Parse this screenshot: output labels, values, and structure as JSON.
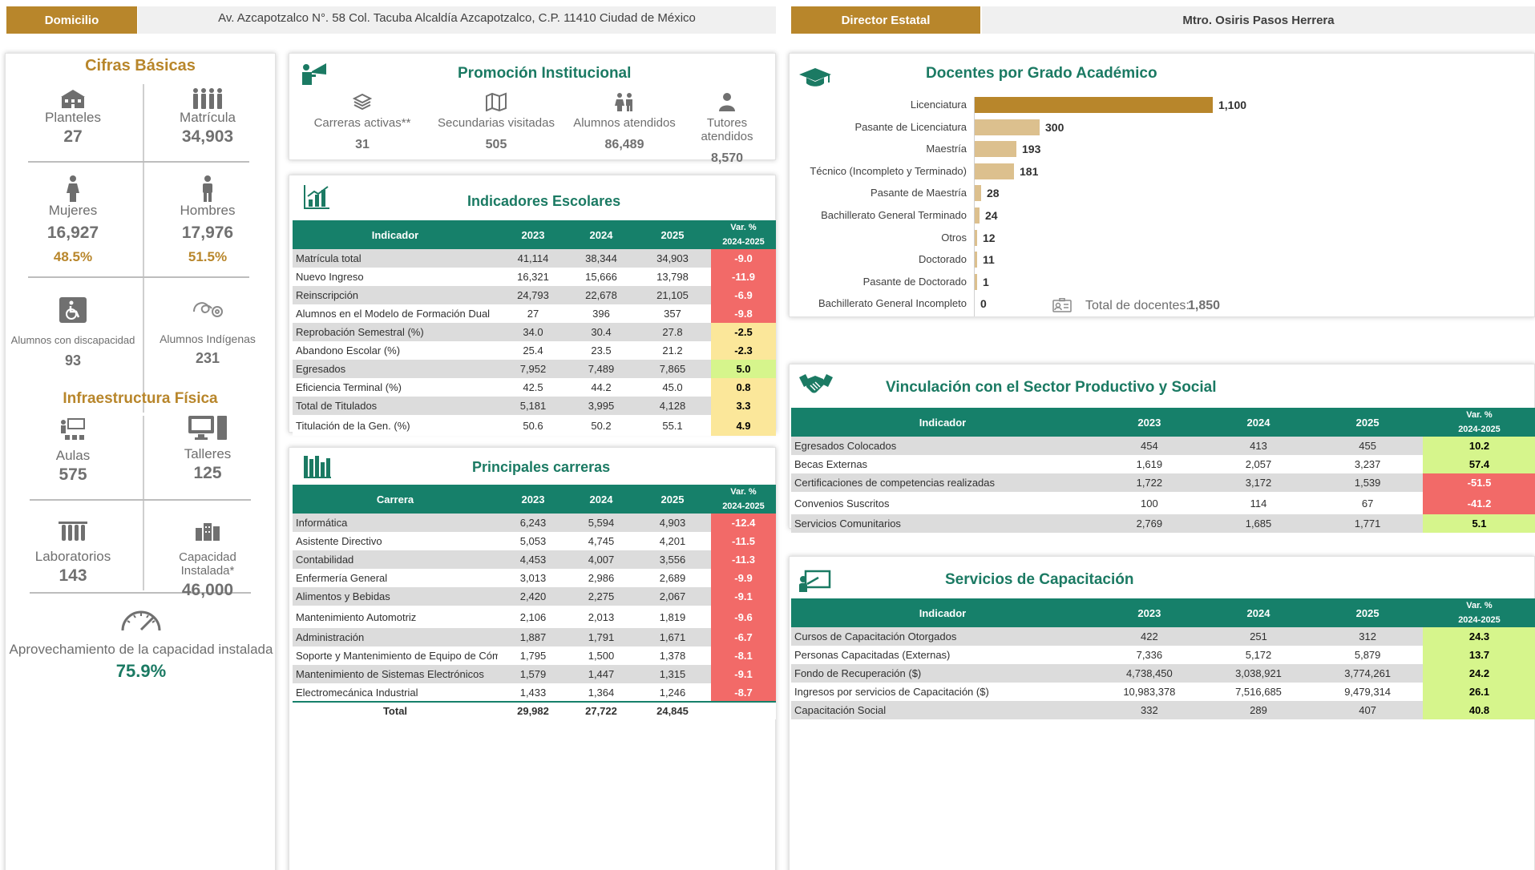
{
  "header": {
    "domicilio_label": "Domicilio",
    "domicilio_value": "Av. Azcapotzalco N°. 58 Col. Tacuba Alcaldía Azcapotzalco, C.P. 11410 Ciudad de México",
    "director_label": "Director Estatal",
    "director_value": "Mtro. Osiris Pasos Herrera"
  },
  "cifras": {
    "title": "Cifras Básicas",
    "planteles_label": "Planteles",
    "planteles_value": "27",
    "matricula_label": "Matrícula",
    "matricula_value": "34,903",
    "mujeres_label": "Mujeres",
    "mujeres_value": "16,927",
    "mujeres_pct": "48.5%",
    "hombres_label": "Hombres",
    "hombres_value": "17,976",
    "hombres_pct": "51.5%",
    "discapacidad_label": "Alumnos con discapacidad",
    "discapacidad_value": "93",
    "indigenas_label": "Alumnos Indígenas",
    "indigenas_value": "231"
  },
  "infraestructura": {
    "title": "Infraestructura Física",
    "aulas_label": "Aulas",
    "aulas_value": "575",
    "talleres_label": "Talleres",
    "talleres_value": "125",
    "laboratorios_label": "Laboratorios",
    "laboratorios_value": "143",
    "capacidad_label": "Capacidad Instalada*",
    "capacidad_value": "46,000",
    "aprovechamiento_label": "Aprovechamiento de la capacidad instalada",
    "aprovechamiento_value": "75.9%"
  },
  "promocion": {
    "title": "Promoción Institucional",
    "carreras_label": "Carreras activas**",
    "carreras_value": "31",
    "secundarias_label": "Secundarias visitadas",
    "secundarias_value": "505",
    "alumnos_label": "Alumnos atendidos",
    "alumnos_value": "86,489",
    "tutores_label": "Tutores atendidos",
    "tutores_value": "8,570"
  },
  "indicadores": {
    "title": "Indicadores Escolares",
    "head": [
      "Indicador",
      "2023",
      "2024",
      "2025",
      "Var. %",
      "2024-2025"
    ],
    "rows": [
      [
        "Matrícula total",
        "41,114",
        "38,344",
        "34,903",
        "-9.0"
      ],
      [
        "Nuevo Ingreso",
        "16,321",
        "15,666",
        "13,798",
        "-11.9"
      ],
      [
        "Reinscripción",
        "24,793",
        "22,678",
        "21,105",
        "-6.9"
      ],
      [
        "Alumnos en el Modelo de Formación Dual",
        "27",
        "396",
        "357",
        "-9.8"
      ],
      [
        "Reprobación Semestral (%)",
        "34.0",
        "30.4",
        "27.8",
        "-2.5"
      ],
      [
        "Abandono Escolar (%)",
        "25.4",
        "23.5",
        "21.2",
        "-2.3"
      ],
      [
        "Egresados",
        "7,952",
        "7,489",
        "7,865",
        "5.0"
      ],
      [
        "Eficiencia Terminal (%)",
        "42.5",
        "44.2",
        "45.0",
        "0.8"
      ],
      [
        "Total de Titulados",
        "5,181",
        "3,995",
        "4,128",
        "3.3"
      ],
      [
        "Titulación de la Gen. (%)",
        "50.6",
        "50.2",
        "55.1",
        "4.9"
      ]
    ]
  },
  "carreras": {
    "title": "Principales carreras",
    "head": [
      "Carrera",
      "2023",
      "2024",
      "2025",
      "Var. %",
      "2024-2025"
    ],
    "rows": [
      [
        "Informática",
        "6,243",
        "5,594",
        "4,903",
        "-12.4"
      ],
      [
        "Asistente Directivo",
        "5,053",
        "4,745",
        "4,201",
        "-11.5"
      ],
      [
        "Contabilidad",
        "4,453",
        "4,007",
        "3,556",
        "-11.3"
      ],
      [
        "Enfermería General",
        "3,013",
        "2,986",
        "2,689",
        "-9.9"
      ],
      [
        "Alimentos y Bebidas",
        "2,420",
        "2,275",
        "2,067",
        "-9.1"
      ],
      [
        "Mantenimiento Automotriz",
        "2,106",
        "2,013",
        "1,819",
        "-9.6"
      ],
      [
        "Administración",
        "1,887",
        "1,791",
        "1,671",
        "-6.7"
      ],
      [
        "Soporte y Mantenimiento de Equipo de Cómputo",
        "1,795",
        "1,500",
        "1,378",
        "-8.1"
      ],
      [
        "Mantenimiento de Sistemas Electrónicos",
        "1,579",
        "1,447",
        "1,315",
        "-9.1"
      ],
      [
        "Electromecánica Industrial",
        "1,433",
        "1,364",
        "1,246",
        "-8.7"
      ]
    ],
    "total": [
      "Total",
      "29,982",
      "27,722",
      "24,845"
    ]
  },
  "docentes": {
    "title": "Docentes por Grado Académico",
    "total_label": "Total de docentes:",
    "total_value": "1,850",
    "chart_data": {
      "type": "bar",
      "categories": [
        "Licenciatura",
        "Pasante de Licenciatura",
        "Maestría",
        "Técnico (Incompleto y Terminado)",
        "Pasante de Maestría",
        "Bachillerato General Terminado",
        "Otros",
        "Doctorado",
        "Pasante de Doctorado",
        "Bachillerato General Incompleto"
      ],
      "values": [
        1100,
        300,
        193,
        181,
        28,
        24,
        12,
        11,
        1,
        0
      ],
      "value_labels": [
        "1,100",
        "300",
        "193",
        "181",
        "28",
        "24",
        "12",
        "11",
        "1",
        "0"
      ],
      "colors": [
        "#b8862b",
        "#dcc08e",
        "#dcc08e",
        "#dcc08e",
        "#dcc08e",
        "#dcc08e",
        "#dcc08e",
        "#dcc08e",
        "#dcc08e",
        "#dcc08e"
      ]
    }
  },
  "vinculacion": {
    "title": "Vinculación con el Sector Productivo y Social",
    "head": [
      "Indicador",
      "2023",
      "2024",
      "2025",
      "Var. %",
      "2024-2025"
    ],
    "rows": [
      [
        "Egresados Colocados",
        "454",
        "413",
        "455",
        "10.2"
      ],
      [
        "Becas Externas",
        "1,619",
        "2,057",
        "3,237",
        "57.4"
      ],
      [
        "Certificaciones de competencias realizadas",
        "1,722",
        "3,172",
        "1,539",
        "-51.5"
      ],
      [
        "Convenios Suscritos",
        "100",
        "114",
        "67",
        "-41.2"
      ],
      [
        "Servicios Comunitarios",
        "2,769",
        "1,685",
        "1,771",
        "5.1"
      ]
    ]
  },
  "capacitacion": {
    "title": "Servicios de Capacitación",
    "head": [
      "Indicador",
      "2023",
      "2024",
      "2025",
      "Var. %",
      "2024-2025"
    ],
    "rows": [
      [
        "Cursos de Capacitación Otorgados",
        "422",
        "251",
        "312",
        "24.3"
      ],
      [
        "Personas Capacitadas (Externas)",
        "7,336",
        "5,172",
        "5,879",
        "13.7"
      ],
      [
        "Fondo de Recuperación ($)",
        "4,738,450",
        "3,038,921",
        "3,774,261",
        "24.2"
      ],
      [
        "Ingresos por servicios de Capacitación ($)",
        "10,983,378",
        "7,516,685",
        "9,479,314",
        "26.1"
      ],
      [
        "Capacitación Social",
        "332",
        "289",
        "407",
        "40.8"
      ]
    ]
  }
}
